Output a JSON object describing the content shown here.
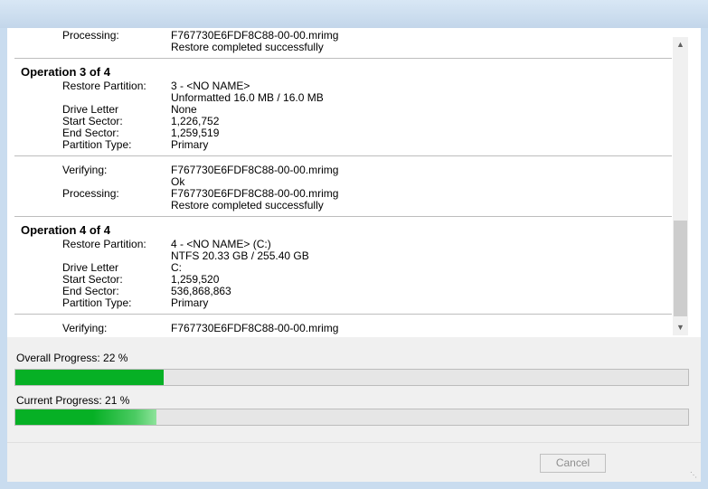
{
  "log": {
    "top_partial": {
      "label": "Processing:",
      "value": "F767730E6FDF8C88-00-00.mrimg",
      "status": "Restore completed successfully"
    },
    "operation3": {
      "title": "Operation 3 of 4",
      "restore_partition_label": "Restore Partition:",
      "restore_partition_value": "3 - <NO NAME>",
      "restore_partition_detail": "Unformatted 16.0 MB / 16.0 MB",
      "drive_letter_label": "Drive Letter",
      "drive_letter_value": "None",
      "start_sector_label": "Start Sector:",
      "start_sector_value": "1,226,752",
      "end_sector_label": "End Sector:",
      "end_sector_value": "1,259,519",
      "partition_type_label": "Partition Type:",
      "partition_type_value": "Primary",
      "verifying_label": "Verifying:",
      "verifying_value": "F767730E6FDF8C88-00-00.mrimg",
      "verifying_status": "Ok",
      "processing_label": "Processing:",
      "processing_value": "F767730E6FDF8C88-00-00.mrimg",
      "processing_status": "Restore completed successfully"
    },
    "operation4": {
      "title": "Operation 4 of 4",
      "restore_partition_label": "Restore Partition:",
      "restore_partition_value": "4 - <NO NAME> (C:)",
      "restore_partition_detail": "NTFS 20.33 GB / 255.40 GB",
      "drive_letter_label": "Drive Letter",
      "drive_letter_value": "C:",
      "start_sector_label": "Start Sector:",
      "start_sector_value": "1,259,520",
      "end_sector_label": "End Sector:",
      "end_sector_value": "536,868,863",
      "partition_type_label": "Partition Type:",
      "partition_type_value": "Primary",
      "verifying_label": "Verifying:",
      "verifying_value": "F767730E6FDF8C88-00-00.mrimg"
    }
  },
  "progress": {
    "overall_label": "Overall Progress:  22 %",
    "overall_percent": 22,
    "current_label": "Current Progress:  21 %",
    "current_percent": 21
  },
  "buttons": {
    "cancel_label": "Cancel"
  },
  "icons": {
    "scroll_up": "scroll-up-arrow-icon",
    "scroll_down": "scroll-down-arrow-icon",
    "resize_grip": "resize-grip-icon"
  },
  "colors": {
    "progress_fill": "#06b025",
    "window_frame": "#c9dcef"
  }
}
